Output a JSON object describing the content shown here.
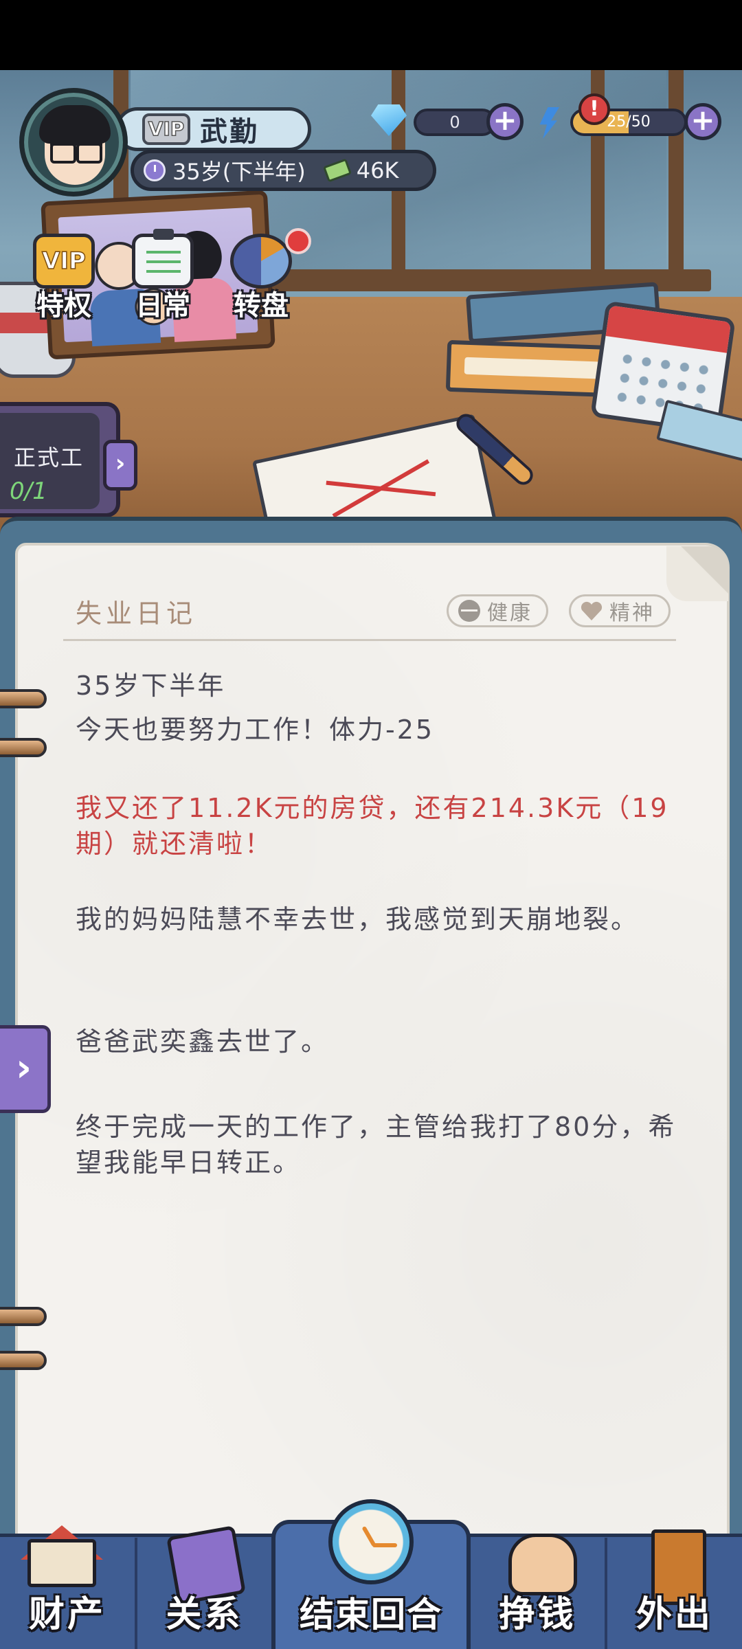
{
  "header": {
    "vip_tag": "VIP",
    "player_name": "武勤",
    "age_text": "35岁(下半年)",
    "cash": "46K",
    "diamonds": "0",
    "energy": "25/50",
    "energy_fraction": 0.5,
    "alert_symbol": "!",
    "plus_symbol": "+"
  },
  "quick_buttons": {
    "vip_privilege": "特权",
    "daily": "日常",
    "wheel": "转盘"
  },
  "task": {
    "title": "正式工",
    "progress": "0/1",
    "arrow": "›"
  },
  "diary": {
    "title": "失业日记",
    "health_label": "健康",
    "spirit_label": "精神",
    "entries": [
      {
        "text": "35岁下半年",
        "color": "#4b4a57"
      },
      {
        "text": "今天也要努力工作！体力-25",
        "color": "#4b4a57"
      },
      {
        "text": "我又还了11.2K元的房贷，还有214.3K元（19期）就还清啦！",
        "color": "#c84343"
      },
      {
        "text": "我的妈妈陆慧不幸去世，我感觉到天崩地裂。",
        "color": "#4b4a57"
      },
      {
        "text": "爸爸武奕鑫去世了。",
        "color": "#4b4a57"
      },
      {
        "text": "终于完成一天的工作了，主管给我打了80分，希望我能早日转正。",
        "color": "#4b4a57"
      }
    ],
    "side_arrow": "›"
  },
  "bottom_nav": {
    "assets": "财产",
    "relations": "关系",
    "end_turn": "结束回合",
    "earn_money": "挣钱",
    "go_out": "外出"
  },
  "colors": {
    "accent_purple": "#8a74c6",
    "diary_red": "#c84343",
    "nav_blue": "#3f5d93"
  },
  "icons": [
    "avatar",
    "vip-icon",
    "clock-icon",
    "cash-icon",
    "diamond-icon",
    "lightning-icon",
    "alert-icon",
    "plus-icon",
    "clipboard-icon",
    "wheel-icon",
    "health-icon",
    "heart-icon",
    "house-icon",
    "book-icon",
    "alarm-clock-icon",
    "fist-money-icon",
    "door-icon"
  ]
}
